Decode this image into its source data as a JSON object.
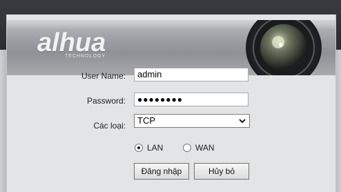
{
  "brand": {
    "logo_text": "alhua",
    "logo_tagline": "TECHNOLOGY"
  },
  "form": {
    "username_label": "User Name:",
    "username_value": "admin",
    "password_label": "Password:",
    "password_mask": "●●●●●●●●",
    "type_label": "Các loại:",
    "type_selected": "TCP"
  },
  "network": {
    "options": [
      {
        "label": "LAN",
        "checked": true
      },
      {
        "label": "WAN",
        "checked": false
      }
    ]
  },
  "buttons": {
    "login_label": "Đăng nhập",
    "cancel_label": "Hủy bỏ"
  }
}
